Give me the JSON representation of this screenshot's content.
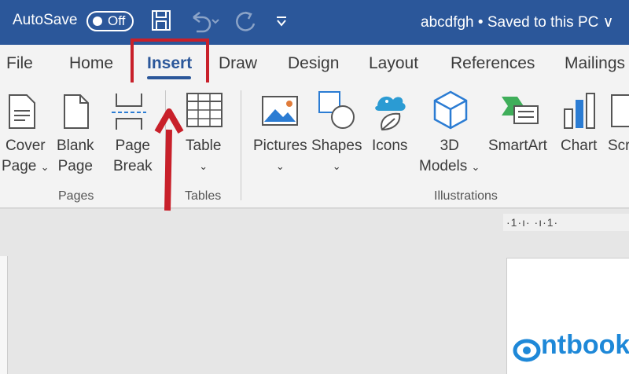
{
  "titlebar": {
    "autosave_label": "AutoSave",
    "toggle_state": "Off",
    "doc_title": "abcdfgh • Saved to this PC",
    "title_chevron": "∨",
    "icons": [
      "save-icon",
      "undo-icon",
      "redo-icon",
      "customize-qat-icon"
    ]
  },
  "tabs": [
    "File",
    "Home",
    "Insert",
    "Draw",
    "Design",
    "Layout",
    "References",
    "Mailings"
  ],
  "active_tab": "Insert",
  "ribbon": {
    "cover_page": {
      "line1": "Cover",
      "line2": "Page",
      "caret": "⌄"
    },
    "blank_page": {
      "line1": "Blank",
      "line2": "Page"
    },
    "page_break": {
      "line1": "Page",
      "line2": "Break"
    },
    "table": {
      "line1": "Table",
      "caret": "⌄"
    },
    "pictures": {
      "line1": "Pictures",
      "caret": "⌄"
    },
    "shapes": {
      "line1": "Shapes",
      "caret": "⌄"
    },
    "icons": {
      "line1": "Icons"
    },
    "models3d": {
      "line1": "3D",
      "line2": "Models",
      "caret": "⌄"
    },
    "smartart": {
      "line1": "SmartArt"
    },
    "chart": {
      "line1": "Chart"
    },
    "screenshot": {
      "line1": "Scr"
    },
    "groups": {
      "pages": "Pages",
      "tables": "Tables",
      "illustrations": "Illustrations"
    }
  },
  "ruler": {
    "text": "·1·ı·   ·ı·1·"
  },
  "watermark": {
    "text": "ntbook"
  },
  "colors": {
    "title_blue": "#2b579a",
    "highlight_red": "#c8202a",
    "watermark_blue": "#1e88d8"
  }
}
